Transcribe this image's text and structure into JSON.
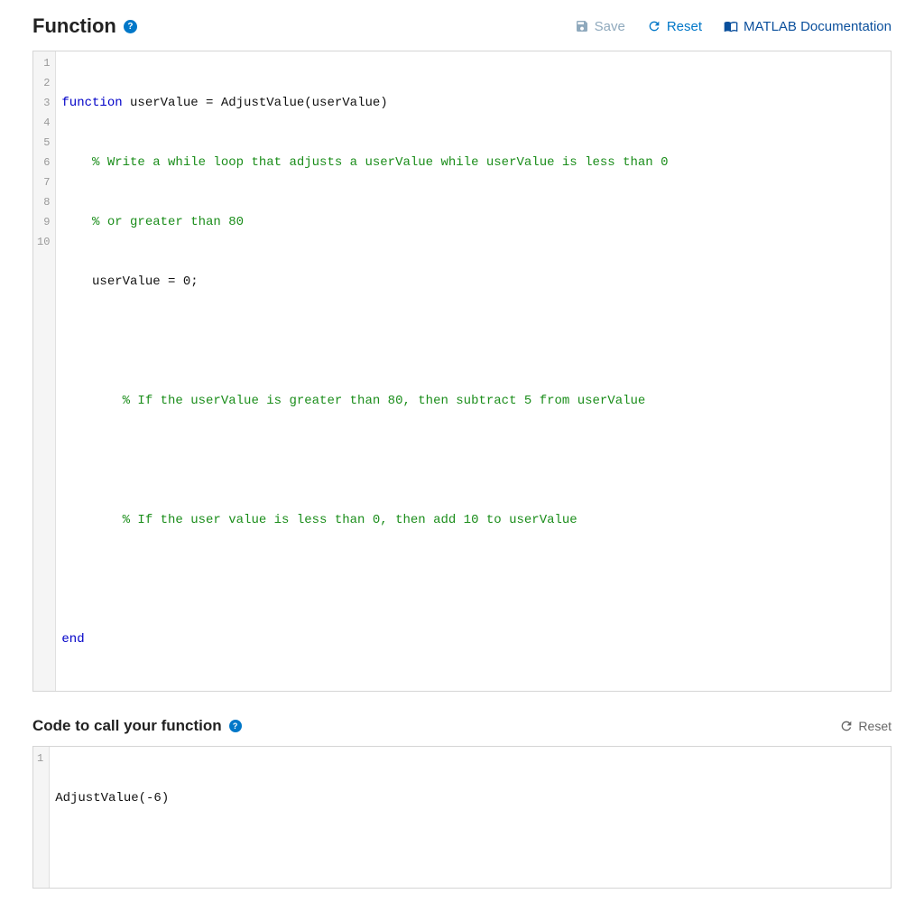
{
  "header": {
    "title": "Function",
    "save_label": "Save",
    "reset_label": "Reset",
    "doc_label": "MATLAB Documentation"
  },
  "editor1": {
    "lines": {
      "l1_kw": "function",
      "l1_rest": " userValue = AdjustValue(userValue)",
      "l2": "    % Write a while loop that adjusts a userValue while userValue is less than 0",
      "l3": "    % or greater than 80",
      "l4": "    userValue = 0;",
      "l5": "",
      "l6": "        % If the userValue is greater than 80, then subtract 5 from userValue",
      "l7": "",
      "l8": "        % If the user value is less than 0, then add 10 to userValue",
      "l9": "",
      "l10": "end"
    },
    "numbers": [
      "1",
      "2",
      "3",
      "4",
      "5",
      "6",
      "7",
      "8",
      "9",
      "10"
    ]
  },
  "section2": {
    "title": "Code to call your function",
    "reset_label": "Reset"
  },
  "editor2": {
    "line1": "AdjustValue(-6)",
    "numbers": [
      "1"
    ]
  }
}
